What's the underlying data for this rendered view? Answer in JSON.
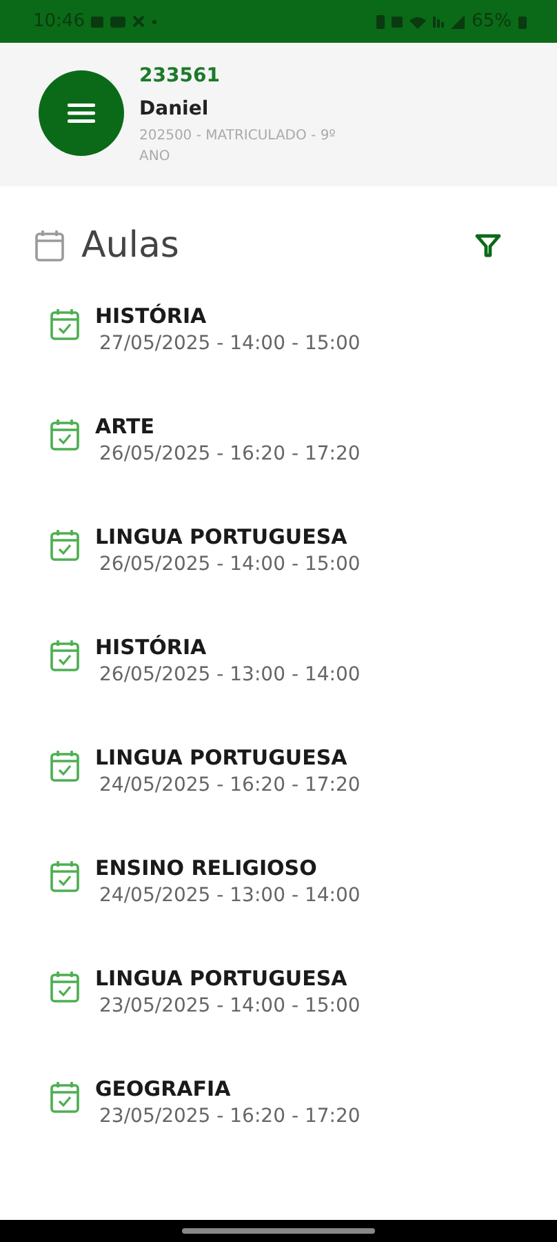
{
  "status_bar": {
    "time": "10:46",
    "battery": "65%"
  },
  "header": {
    "code": "233561",
    "name": "Daniel",
    "details": "202500 - MATRICULADO - 9º ANO"
  },
  "section": {
    "title": "Aulas"
  },
  "classes": [
    {
      "subject": "HISTÓRIA",
      "when": "27/05/2025 - 14:00 - 15:00"
    },
    {
      "subject": "ARTE",
      "when": "26/05/2025 - 16:20 - 17:20"
    },
    {
      "subject": "LINGUA PORTUGUESA",
      "when": "26/05/2025 - 14:00 - 15:00"
    },
    {
      "subject": "HISTÓRIA",
      "when": "26/05/2025 - 13:00 - 14:00"
    },
    {
      "subject": "LINGUA PORTUGUESA",
      "when": "24/05/2025 - 16:20 - 17:20"
    },
    {
      "subject": "ENSINO RELIGIOSO",
      "when": "24/05/2025 - 13:00 - 14:00"
    },
    {
      "subject": "LINGUA PORTUGUESA",
      "when": "23/05/2025 - 14:00 - 15:00"
    },
    {
      "subject": "GEOGRAFIA",
      "when": "23/05/2025 - 16:20 - 17:20"
    }
  ]
}
